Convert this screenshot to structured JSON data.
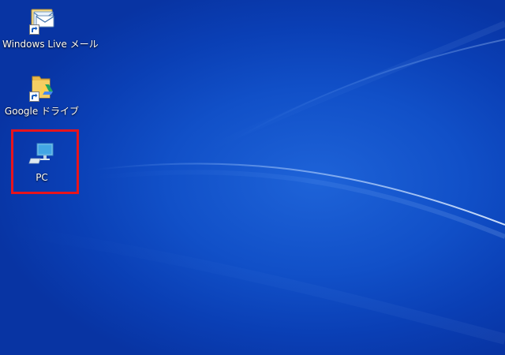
{
  "desktop": {
    "icons": [
      {
        "id": "windows-live-mail",
        "label": "Windows Live メール",
        "shortcut": true,
        "icon": "mail-envelope-icon"
      },
      {
        "id": "google-drive",
        "label": "Google ドライブ",
        "shortcut": true,
        "icon": "google-drive-folder-icon"
      },
      {
        "id": "pc",
        "label": "PC",
        "shortcut": false,
        "icon": "computer-monitor-icon",
        "highlighted": true
      }
    ],
    "colors": {
      "background": "#1150c8",
      "highlight": "#e8141c"
    }
  }
}
